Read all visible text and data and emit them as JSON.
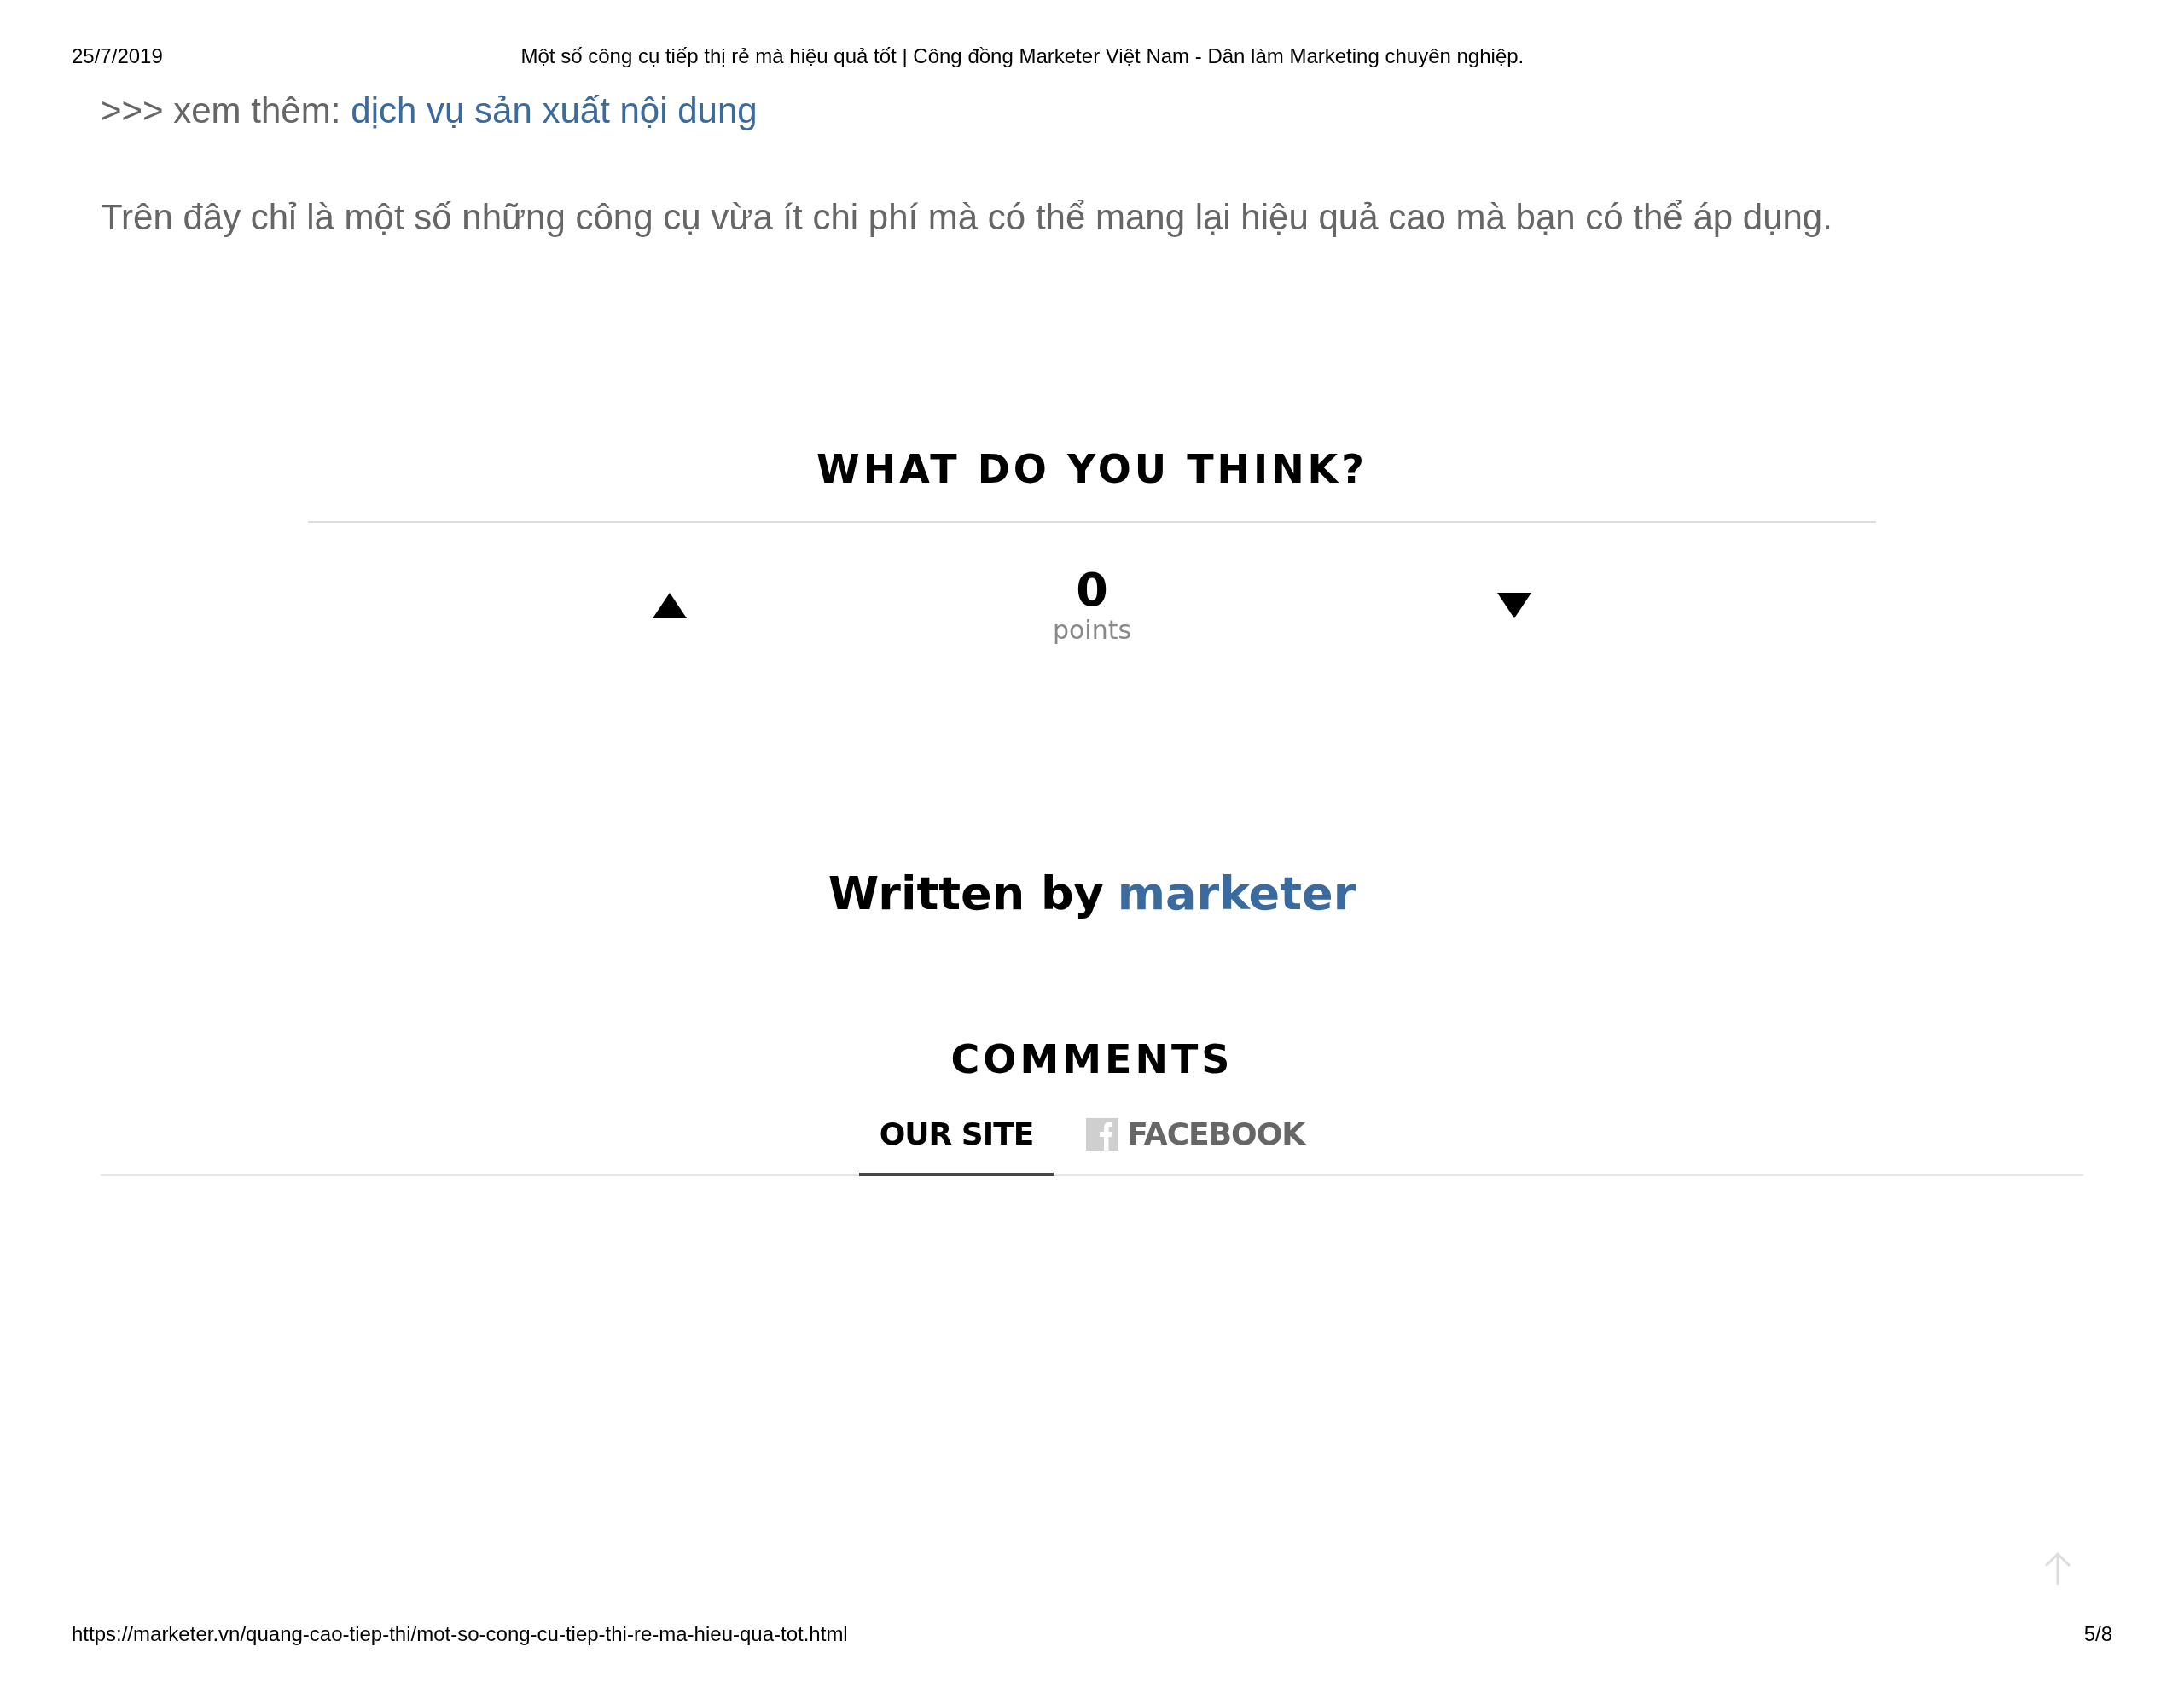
{
  "print_header": {
    "date": "25/7/2019",
    "title": "Một số công cụ tiếp thị rẻ mà hiệu quả tốt | Công đồng Marketer Việt Nam - Dân làm Marketing chuyên nghiệp."
  },
  "see_more": {
    "prefix": ">>> xem thêm:",
    "link": "dịch vụ sản xuất nội dung"
  },
  "paragraph": "Trên đây chỉ là một số những công cụ vừa ít chi phí mà có thể mang lại hiệu quả cao mà bạn có thể áp dụng.",
  "vote": {
    "heading": "WHAT DO YOU THINK?",
    "score": "0",
    "unit": "points"
  },
  "author": {
    "prefix": "Written by",
    "name": "marketer"
  },
  "comments": {
    "heading": "COMMENTS",
    "tabs": [
      {
        "label": "OUR SITE",
        "kind": "plain",
        "selected": true
      },
      {
        "label": "FACEBOOK",
        "kind": "facebook",
        "selected": false
      }
    ]
  },
  "print_footer": {
    "url": "https://marketer.vn/quang-cao-tiep-thi/mot-so-cong-cu-tiep-thi-re-ma-hieu-qua-tot.html",
    "page": "5/8"
  }
}
